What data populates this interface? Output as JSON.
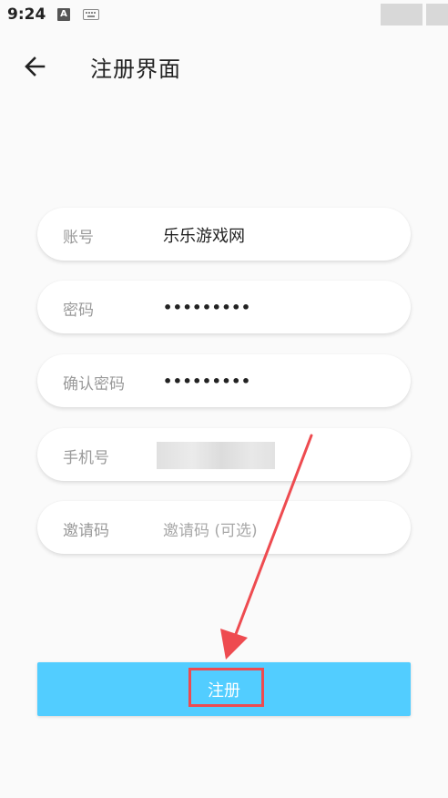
{
  "status_bar": {
    "time": "9:24",
    "icons": [
      "a-icon",
      "keyboard-icon"
    ]
  },
  "app_bar": {
    "title": "注册界面",
    "back_icon": "arrow-left-icon"
  },
  "form": {
    "account": {
      "label": "账号",
      "value": "乐乐游戏网"
    },
    "password": {
      "label": "密码",
      "value": "•••••••••"
    },
    "confirm_password": {
      "label": "确认密码",
      "value": "•••••••••"
    },
    "phone": {
      "label": "手机号",
      "value": ""
    },
    "invite_code": {
      "label": "邀请码",
      "placeholder": "邀请码 (可选)"
    }
  },
  "register_button": {
    "label": "注册"
  },
  "colors": {
    "button_bg": "#52cdff",
    "annotation_red": "#ee4b50",
    "background": "#fafafa"
  }
}
